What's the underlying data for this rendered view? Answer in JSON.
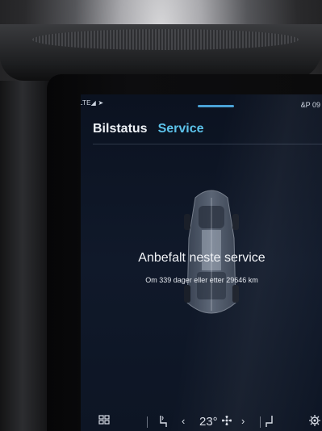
{
  "status_bar": {
    "left": "LTE◢ ➤",
    "right": "&P 09"
  },
  "tabs": [
    {
      "label": "Bilstatus",
      "active": false
    },
    {
      "label": "Service",
      "active": true
    }
  ],
  "service": {
    "title": "Anbefalt neste service",
    "subtitle": "Om 339 dager eller etter 29646 km"
  },
  "climate_bar": {
    "temperature": "23°",
    "fan_icon": "fan-icon",
    "left_arrow": "‹",
    "right_arrow": "›"
  },
  "colors": {
    "accent": "#5cc2ea",
    "screen_bg": "#0f1828",
    "text": "#eef1f6"
  }
}
